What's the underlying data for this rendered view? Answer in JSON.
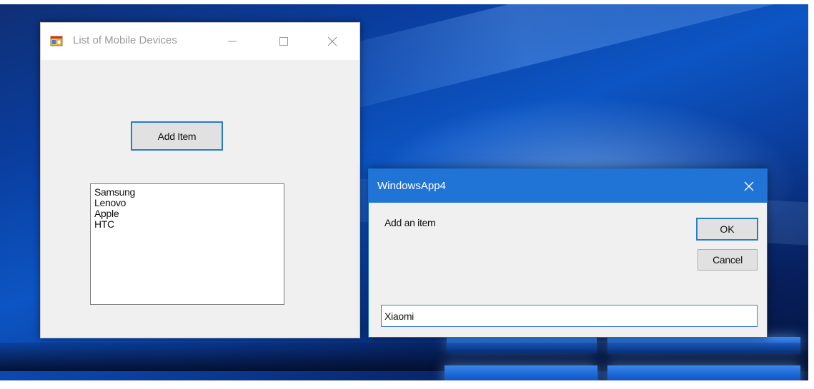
{
  "main_window": {
    "title": "List of Mobile Devices",
    "add_button_label": "Add Item",
    "list_items": [
      "Samsung",
      "Lenovo",
      "Apple",
      "HTC"
    ]
  },
  "dialog": {
    "title": "WindowsApp4",
    "prompt": "Add an item",
    "ok_label": "OK",
    "cancel_label": "Cancel",
    "input_value": "Xiaomi"
  },
  "colors": {
    "accent": "#1f74d6",
    "focus_border": "#2a7cc7",
    "window_bg": "#f0f0f0"
  }
}
